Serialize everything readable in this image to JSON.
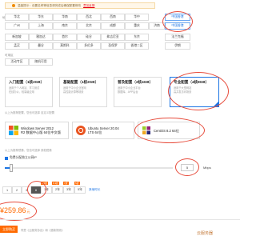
{
  "tip": {
    "text": "温馨提示：设置名称等信息请完成后确保配置修改",
    "link": "意见反馈"
  },
  "regions": {
    "row_label": "地域",
    "items": [
      "华北",
      "华东",
      "华南",
      "西北",
      "西南",
      "华中",
      "中国香港"
    ],
    "selected": "中国香港"
  },
  "zones": [
    "广州",
    "上海",
    "南京",
    "北京",
    "成都",
    "重庆",
    "济南"
  ],
  "zone_extra": [
    "中国香港"
  ],
  "subzones": [
    "新加坡",
    "雅加达",
    "首尔",
    "硅谷",
    "弗吉尼亚",
    "东京",
    "法兰克福"
  ],
  "subzones2": [
    "孟买",
    "曼谷",
    "莫斯科",
    "多伦多",
    "圣保罗",
    "香港二区",
    "伊朗"
  ],
  "az_section": {
    "label": "可用区",
    "items": [
      "活动专区",
      "随机可用"
    ]
  },
  "configs": [
    {
      "title": "入门配置（1核2GB）",
      "lines": [
        "适用于个人网站、学习测试",
        "在线办公、轻量级应用"
      ]
    },
    {
      "title": "基础配置（1核2GB）",
      "lines": [
        "适用于中小企业官网",
        "高性能计算等场景"
      ]
    },
    {
      "title": "普及配置（2核4GB）",
      "lines": [
        "适用于中小企业平台",
        "数据库、APP后台"
      ]
    },
    {
      "title": "专业配置（4核8GB）",
      "lines": [
        "适用于大型网站",
        "高并发访问场景"
      ]
    }
  ],
  "config_note": "以上为推荐配置，您也可选择 自定义配置",
  "images": [
    {
      "name": "Windows Server 2012",
      "sub": "R2 数据中心版 64位中文版",
      "icon": "windows-icon"
    },
    {
      "name": "Ubuntu Server 20.04",
      "sub": "LTS 64位",
      "icon": "ubuntu-icon"
    },
    {
      "name": "CentOS 8.2 64位",
      "sub": "",
      "icon": "centos-icon"
    }
  ],
  "image_note": "以上为推荐镜像，您也可选择 其他镜像",
  "bandwidth": {
    "checkbox_label": "免费分配独立公网IP",
    "value": "5",
    "unit": "Mbps"
  },
  "duration": {
    "options": [
      "1",
      "2",
      "3",
      "6",
      "1年",
      "2年",
      "3年",
      "5年"
    ],
    "tags": [
      "8.5折",
      "8.3折",
      "7折",
      "5折"
    ],
    "selected": "6",
    "more": "其他时长"
  },
  "price": {
    "value": "259.86",
    "unit": "元",
    "prefix": "¥"
  },
  "buy_button": "立即购买",
  "agreement": "同意《云服务协议》和《退款规则》",
  "watermark": "云服务器",
  "colors": {
    "accent": "#1b74e4",
    "price": "#ff6a00",
    "highlight": "#e74c3c",
    "buy": "#ff6a00"
  }
}
